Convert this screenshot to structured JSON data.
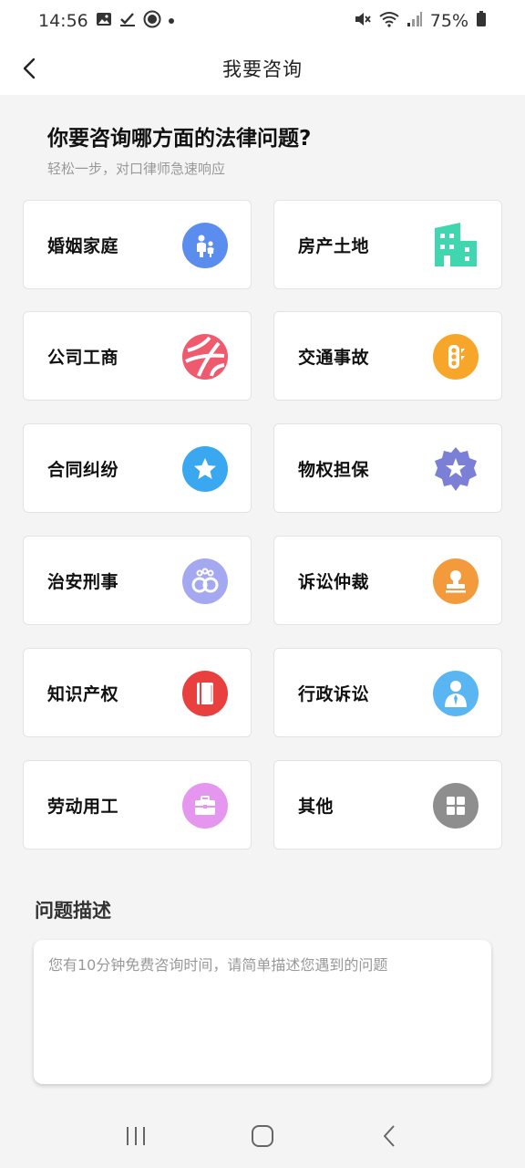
{
  "status": {
    "time": "14:56",
    "battery": "75%"
  },
  "appbar": {
    "title": "我要咨询"
  },
  "intro": {
    "heading": "你要咨询哪方面的法律问题?",
    "subheading": "轻松一步，对口律师急速响应"
  },
  "categories": [
    {
      "label": "婚姻家庭",
      "icon": "family-icon",
      "color": "#5b8def"
    },
    {
      "label": "房产土地",
      "icon": "building-icon",
      "color": "#3fd6b0"
    },
    {
      "label": "公司工商",
      "icon": "globe-icon",
      "color": "#ef5a6e"
    },
    {
      "label": "交通事故",
      "icon": "traffic-light-icon",
      "color": "#f7a62a"
    },
    {
      "label": "合同纠纷",
      "icon": "star-icon",
      "color": "#3aa8f0"
    },
    {
      "label": "物权担保",
      "icon": "badge-star-icon",
      "color": "#7b7fd6"
    },
    {
      "label": "治安刑事",
      "icon": "handcuffs-icon",
      "color": "#a4a8f0"
    },
    {
      "label": "诉讼仲裁",
      "icon": "stamp-icon",
      "color": "#f39a3c"
    },
    {
      "label": "知识产权",
      "icon": "book-icon",
      "color": "#e8403e"
    },
    {
      "label": "行政诉讼",
      "icon": "official-icon",
      "color": "#5ab6f2"
    },
    {
      "label": "劳动用工",
      "icon": "briefcase-icon",
      "color": "#e596ee"
    },
    {
      "label": "其他",
      "icon": "grid-icon",
      "color": "#8e8e8e"
    }
  ],
  "description": {
    "title": "问题描述",
    "placeholder": "您有10分钟免费咨询时间，请简单描述您遇到的问题"
  }
}
